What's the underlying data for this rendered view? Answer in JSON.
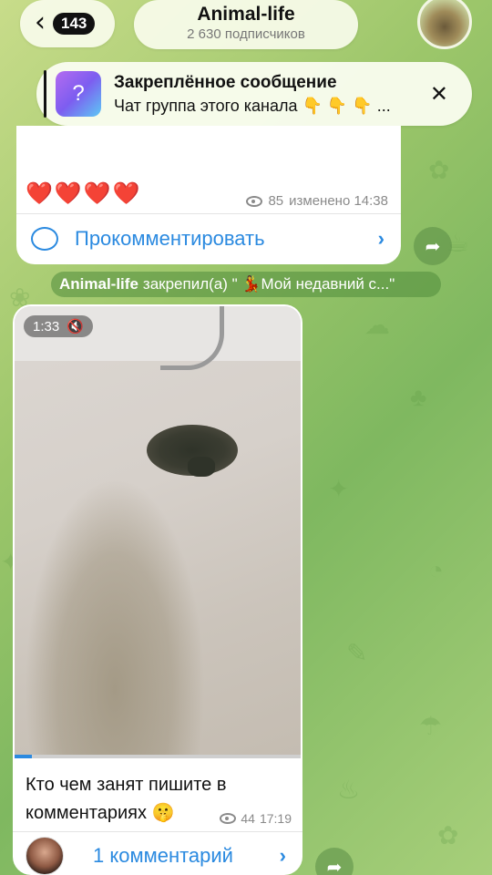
{
  "header": {
    "back_count": "143",
    "channel_name": "Animal-life",
    "subscribers": "2 630 подписчиков"
  },
  "pinned": {
    "title": "Закреплённое сообщение",
    "text": "Чат группа этого канала 👇 👇 👇 ..."
  },
  "post1": {
    "hearts": "❤️❤️❤️❤️",
    "views": "85",
    "edited": "изменено 14:38",
    "comment_label": "Прокомментировать"
  },
  "service_message": {
    "actor": "Animal-life",
    "text": "закрепил(а) \" 💃Мой недавний с...\""
  },
  "post2": {
    "video_time": "1:33",
    "video_progress": 0.06,
    "caption": "Кто чем занят пишите в комментариях 🤫",
    "views": "44",
    "time": "17:19",
    "comment_label": "1 комментарий"
  },
  "colors": {
    "accent": "#2b8ae0",
    "heart": "#e01e2a"
  }
}
